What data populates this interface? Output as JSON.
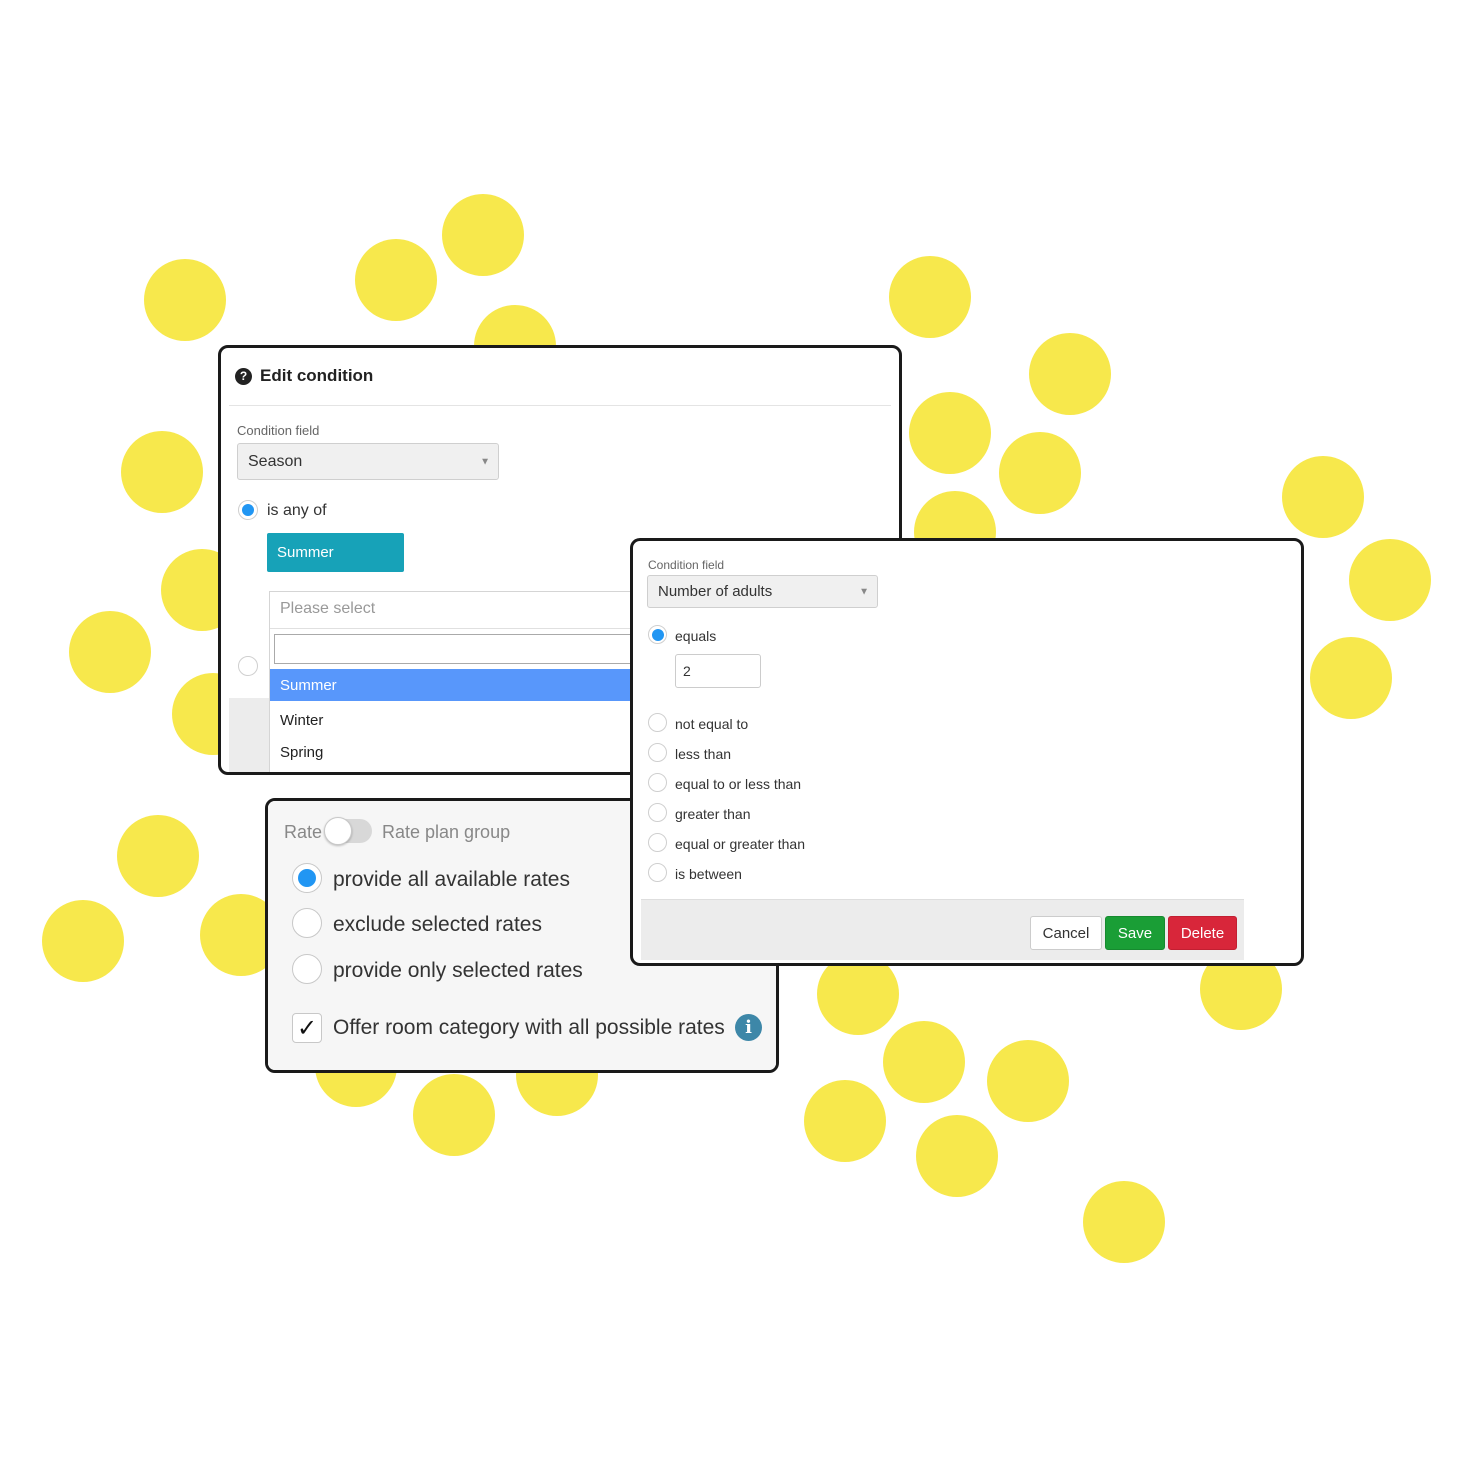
{
  "colors": {
    "accent": "#2196f3",
    "tag": "#17a2b8",
    "highlight": "#5897fb",
    "save": "#1a9e36",
    "delete": "#d8263a",
    "dots": "#f7e84c"
  },
  "edit_condition": {
    "title": "Edit condition",
    "help_icon": "question-circle-icon",
    "condition_field_label": "Condition field",
    "condition_field_value": "Season",
    "operator_label": "is any of",
    "selected_tag": "Summer",
    "dropdown": {
      "placeholder": "Please select",
      "search_value": "",
      "options": [
        "Summer",
        "Winter",
        "Spring"
      ],
      "highlighted": "Summer"
    }
  },
  "rate_options": {
    "toggle_left_label": "Rate",
    "toggle_right_label": "Rate plan group",
    "radios": [
      "provide all available rates",
      "exclude selected rates",
      "provide only selected rates"
    ],
    "selected_radio": "provide all available rates",
    "checkbox_label": "Offer room category with all possible rates",
    "checkbox_checked": true,
    "checkmark": "✓",
    "info_icon": "info-circle-icon"
  },
  "adults_condition": {
    "condition_field_label": "Condition field",
    "condition_field_value": "Number of adults",
    "operators": [
      "equals",
      "not equal to",
      "less than",
      "equal to or less than",
      "greater than",
      "equal or greater than",
      "is between"
    ],
    "selected_operator": "equals",
    "equals_value": "2",
    "buttons": {
      "cancel": "Cancel",
      "save": "Save",
      "delete": "Delete"
    }
  }
}
